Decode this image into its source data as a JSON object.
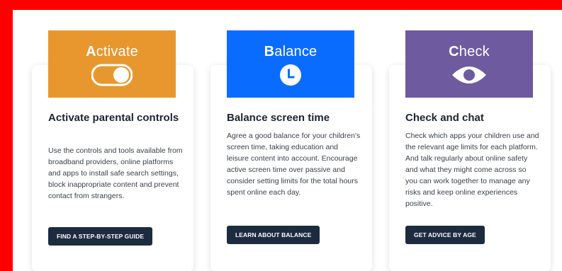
{
  "cards": [
    {
      "tile_lead": "A",
      "tile_rest": "ctivate",
      "tile_icon": "toggle-switch-icon",
      "tile_color": "#e8972e",
      "title": "Activate parental controls",
      "text": "Use the controls and tools available from broadband providers, online platforms and apps to install safe search settings, block inappropriate content and prevent contact from strangers.",
      "button_label": "FIND A STEP-BY-STEP GUIDE"
    },
    {
      "tile_lead": "B",
      "tile_rest": "alance",
      "tile_icon": "clock-icon",
      "tile_color": "#0a6cff",
      "title": "Balance screen time",
      "text": "Agree a good balance for your children's screen time, taking education and leisure content into account. Encourage active screen time over passive and consider setting limits for the total hours spent online each day.",
      "button_label": "LEARN ABOUT BALANCE"
    },
    {
      "tile_lead": "C",
      "tile_rest": "heck",
      "tile_icon": "eye-icon",
      "tile_color": "#6e5a9e",
      "title": "Check and chat",
      "text": "Check which apps your children use and the relevant age limits for each platform. And talk regularly about online safety and what they might come across so you can work together to manage any risks and keep online experiences positive.",
      "button_label": "GET ADVICE BY AGE"
    }
  ],
  "colors": {
    "page_border": "#fc0000",
    "button_bg": "#1d2b3f",
    "heading": "#1d2533"
  }
}
